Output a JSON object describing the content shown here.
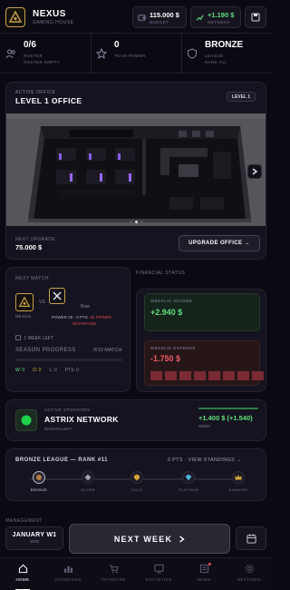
{
  "header": {
    "team_name": "NEXUS",
    "team_sub": "GAMING HOUSE",
    "budget_value": "115.000 $",
    "budget_label": "BUDGET",
    "networth_value": "+1.190 $",
    "networth_label": "NETWEEK"
  },
  "stats": {
    "roster_value": "0/6",
    "roster_label": "ROSTER",
    "roster_sub": "ROSTER EMPTY",
    "power_value": "0",
    "power_label": "TEAM POWER",
    "league_value": "BRONZE",
    "league_label": "LEAGUE",
    "league_sub": "RANK #11"
  },
  "office": {
    "tag": "ACTIVE OFFICE",
    "title": "LEVEL 1 OFFICE",
    "level": "LEVEL 1",
    "next_upgrade_label": "NEXT UPGRADE",
    "next_upgrade_value": "75.000 $",
    "upgrade_button": "UPGRADE OFFICE →",
    "slide_index": 1,
    "slide_count": 3
  },
  "match": {
    "label": "NEXT MATCH",
    "vs": "VS",
    "team_a": "NEXUS",
    "opponent": "Row",
    "power_line": "POWER 25 - 0 PTS",
    "power_adv": "-25 POWER",
    "power_adv2": "ADVANTAGE",
    "weeks_left": "1 WEEK LEFT",
    "season_label": "SEASON PROGRESS",
    "season_value": "0/10 MATCH",
    "season_progress": 0,
    "wins": "W: 0",
    "draws": "D: 0",
    "losses": "L: 0",
    "pts": "PTS: 0"
  },
  "finance": {
    "label": "FINANCIAL STATUS",
    "income_title": "WEEKLIK INCOME",
    "income_value": "+2.940 $",
    "expense_title": "WEEKLIK EXPENSE",
    "expense_value": "-1.750 $"
  },
  "sponsor": {
    "label": "ACTIVE SPONSORS",
    "name": "ASTRIX NETWORK",
    "days": "30 DAYS LEFT",
    "amount": "+1.400 $ (+1.540)",
    "sub": "WEEK"
  },
  "league": {
    "title": "BRONZE LEAGUE — RANK #11",
    "link": "0 PTS · VIEW STANDINGS →",
    "tiers": [
      {
        "name": "BRONZE",
        "color": "#b87a3e"
      },
      {
        "name": "SILVER",
        "color": "#9ea3b3"
      },
      {
        "name": "GOLD",
        "color": "#d4a23a"
      },
      {
        "name": "PLATINUM",
        "color": "#4fb4d8"
      },
      {
        "name": "DIAMOND",
        "color": "#d8a93b"
      }
    ]
  },
  "controls": {
    "management_label": "MANAGEMENT",
    "date_main": "JANUARY W1",
    "date_sub": "2025",
    "next_week": "NEXT WEEK"
  },
  "nav": [
    {
      "label": "HOME",
      "icon": "home-icon"
    },
    {
      "label": "STANDINGS",
      "icon": "standings-icon"
    },
    {
      "label": "TRANSFER",
      "icon": "transfer-icon"
    },
    {
      "label": "STATISTICS",
      "icon": "statistics-icon"
    },
    {
      "label": "NEWS",
      "icon": "news-icon"
    },
    {
      "label": "SETTINGS",
      "icon": "settings-icon"
    }
  ],
  "colors": {
    "accent_gold": "#c9a24a",
    "positive": "#62e07b",
    "negative": "#ef5a66",
    "background": "#0b0a13"
  }
}
